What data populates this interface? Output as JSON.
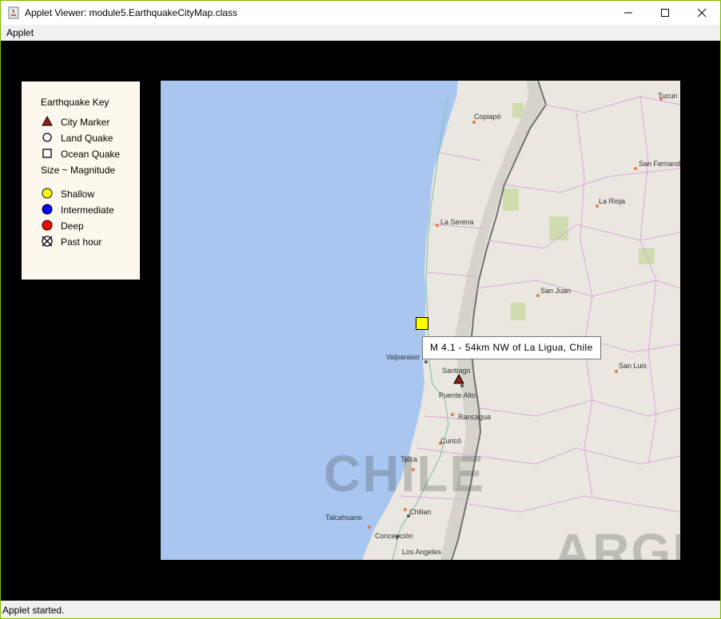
{
  "window": {
    "title": "Applet Viewer: module5.EarthquakeCityMap.class",
    "menu": "Applet",
    "status": "Applet started."
  },
  "key": {
    "title": "Earthquake Key",
    "items": [
      {
        "label": "City Marker",
        "icon": "city-triangle-icon"
      },
      {
        "label": "Land Quake",
        "icon": "land-circle-icon"
      },
      {
        "label": "Ocean Quake",
        "icon": "ocean-square-icon"
      },
      {
        "label": "Size ~ Magnitude"
      },
      {
        "label": "Shallow",
        "icon": "shallow-yellow-icon",
        "color": "#ffff00"
      },
      {
        "label": "Intermediate",
        "icon": "intermediate-blue-icon",
        "color": "#0000ff"
      },
      {
        "label": "Deep",
        "icon": "deep-red-icon",
        "color": "#ff0000"
      },
      {
        "label": "Past hour",
        "icon": "past-hour-icon"
      }
    ]
  },
  "map": {
    "places": [
      "Copiapó",
      "Tucun",
      "San Fernand",
      "La Rioja",
      "La Serena",
      "San Juan",
      "Valparaiso",
      "Santiago",
      "Puente Alto",
      "San Luis",
      "Rancagua",
      "Curicó",
      "Talca",
      "Chillan",
      "Talcahuano",
      "Concepción",
      "Los Angeles"
    ],
    "country_labels": [
      "CHILE",
      "ARGE"
    ],
    "tooltip": "M 4.1 - 54km NW of La Ligua, Chile"
  }
}
